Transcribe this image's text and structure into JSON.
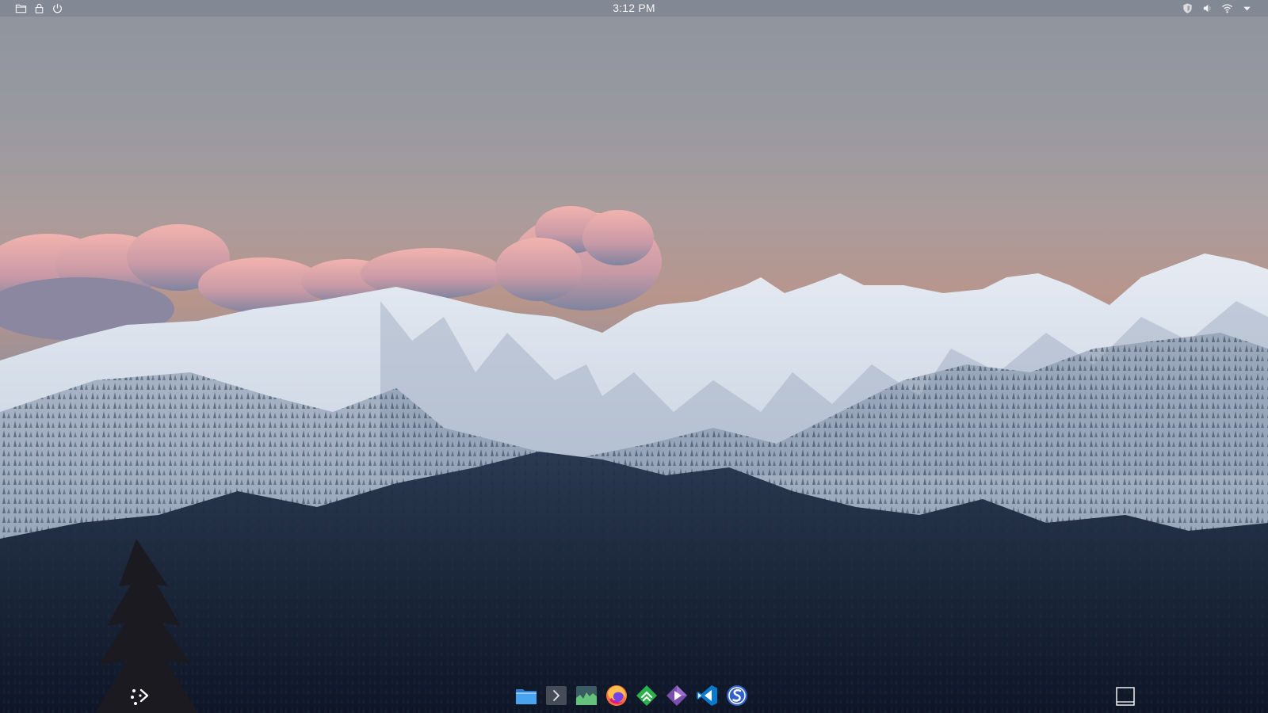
{
  "panel": {
    "clock": "3:12 PM",
    "left_icons": [
      "folder-icon",
      "lock-icon",
      "power-icon"
    ],
    "right_icons": [
      "shield-icon",
      "volume-icon",
      "wifi-icon",
      "dropdown-arrow-icon"
    ]
  },
  "desktop": {
    "wallpaper": "snowy-mountains-at-dusk"
  },
  "dock": {
    "apps": [
      {
        "id": "files",
        "icon": "files-folder-icon"
      },
      {
        "id": "terminal",
        "icon": "terminal-icon"
      },
      {
        "id": "system-monitor",
        "icon": "system-monitor-icon"
      },
      {
        "id": "firefox",
        "icon": "firefox-icon"
      },
      {
        "id": "feedly",
        "icon": "feedly-icon"
      },
      {
        "id": "kodi",
        "icon": "diamond-play-icon"
      },
      {
        "id": "vscode",
        "icon": "vscode-icon"
      },
      {
        "id": "simplenote",
        "icon": "simplenote-icon"
      }
    ],
    "launcher_icon": "app-launcher-icon",
    "show_desktop_icon": "show-desktop-icon"
  },
  "colors": {
    "sky_top": "#8e949e",
    "sky_glow": "#b7938a",
    "cloud": "#e9a4a2",
    "snow": "#dfe6f0",
    "forest": "#152235",
    "panel_text": "#f2f2f2"
  }
}
